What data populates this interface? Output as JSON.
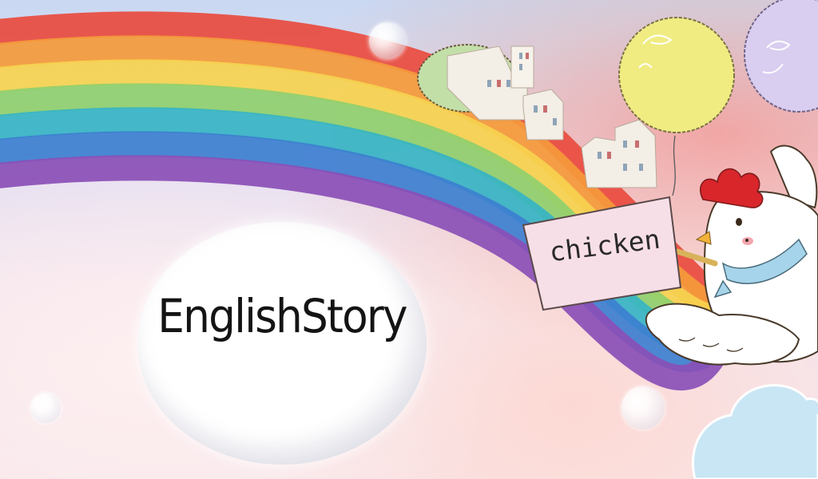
{
  "title": "EnglishStory",
  "sign_word": "chicken",
  "colors": {
    "rainbow": [
      "#e94b3f",
      "#f49a3b",
      "#f6d34f",
      "#8fcf6e",
      "#36b4c4",
      "#3d7fd0",
      "#8a4fb6"
    ],
    "balloon_yellow": "#f0ec82",
    "balloon_purple": "#d9cdf0",
    "sign_paper": "#f7dfe8",
    "chicken_comb": "#d8262b",
    "chicken_scarf": "#a6d4ea"
  },
  "icons": [
    "rainbow-icon",
    "balloon-icon",
    "chicken-icon",
    "cloud-icon",
    "bubble-icon",
    "building-icon",
    "tree-icon"
  ]
}
